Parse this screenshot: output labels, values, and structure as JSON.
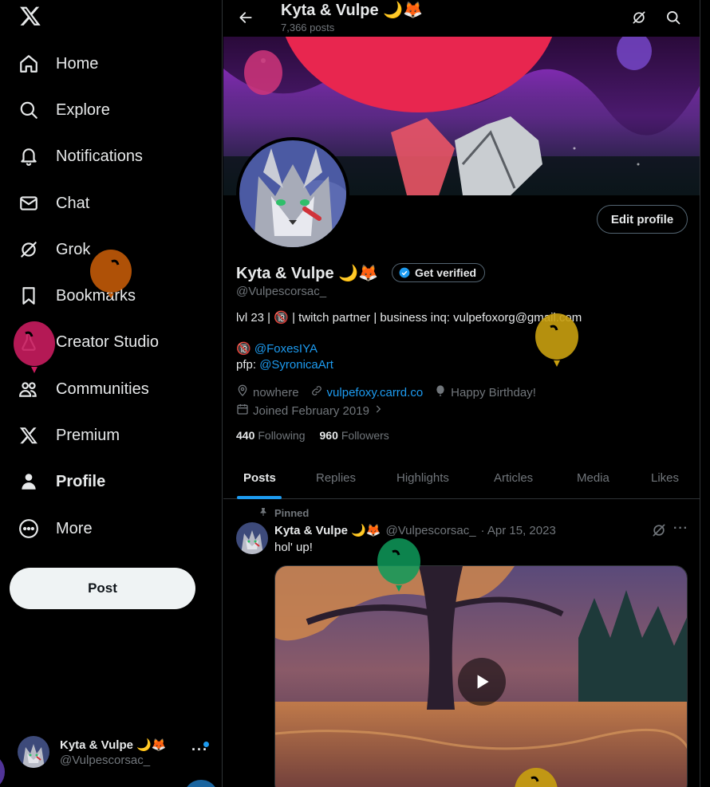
{
  "sidebar": {
    "items": [
      {
        "label": "Home",
        "icon": "home-icon"
      },
      {
        "label": "Explore",
        "icon": "search-icon"
      },
      {
        "label": "Notifications",
        "icon": "bell-icon"
      },
      {
        "label": "Chat",
        "icon": "mail-icon"
      },
      {
        "label": "Grok",
        "icon": "grok-icon"
      },
      {
        "label": "Bookmarks",
        "icon": "bookmark-icon"
      },
      {
        "label": "Creator Studio",
        "icon": "flask-icon"
      },
      {
        "label": "Communities",
        "icon": "people-icon"
      },
      {
        "label": "Premium",
        "icon": "x-logo-icon"
      },
      {
        "label": "Profile",
        "icon": "person-icon",
        "active": true
      },
      {
        "label": "More",
        "icon": "more-circle-icon"
      }
    ],
    "post_label": "Post",
    "account": {
      "name": "Kyta & Vulpe 🌙🦊",
      "handle": "@Vulpescorsac_",
      "more": "···"
    }
  },
  "header": {
    "title": "Kyta & Vulpe 🌙🦊",
    "subtitle": "7,366 posts"
  },
  "profile": {
    "name": "Kyta & Vulpe 🌙🦊",
    "verify_label": "Get verified",
    "handle": "@Vulpescorsac_",
    "edit_label": "Edit profile",
    "bio_line1": "lvl 23 | 🔞 | twitch partner | business inq: vulpefoxorg@gmail.com",
    "bio_line2_prefix": "🔞 ",
    "bio_line2_link": "@FoxesIYA",
    "bio_line3_prefix": "pfp: ",
    "bio_line3_link": "@SyronicaArt",
    "location": "nowhere",
    "website": "vulpefoxy.carrd.co",
    "birthday": "Happy Birthday!",
    "joined": "Joined February 2019",
    "following_count": "440",
    "following_label": "Following",
    "followers_count": "960",
    "followers_label": "Followers"
  },
  "tabs": [
    "Posts",
    "Replies",
    "Highlights",
    "Articles",
    "Media",
    "Likes"
  ],
  "pinned_post": {
    "pinned_label": "Pinned",
    "name": "Kyta & Vulpe 🌙🦊",
    "handle": "@Vulpescorsac_",
    "date": "· Apr 15, 2023",
    "more": "···",
    "text": "hol' up!"
  },
  "colors": {
    "accent": "#1d9bf0",
    "background": "#000000",
    "text": "#e7e9ea",
    "muted": "#71767b",
    "border": "#2f3336"
  }
}
